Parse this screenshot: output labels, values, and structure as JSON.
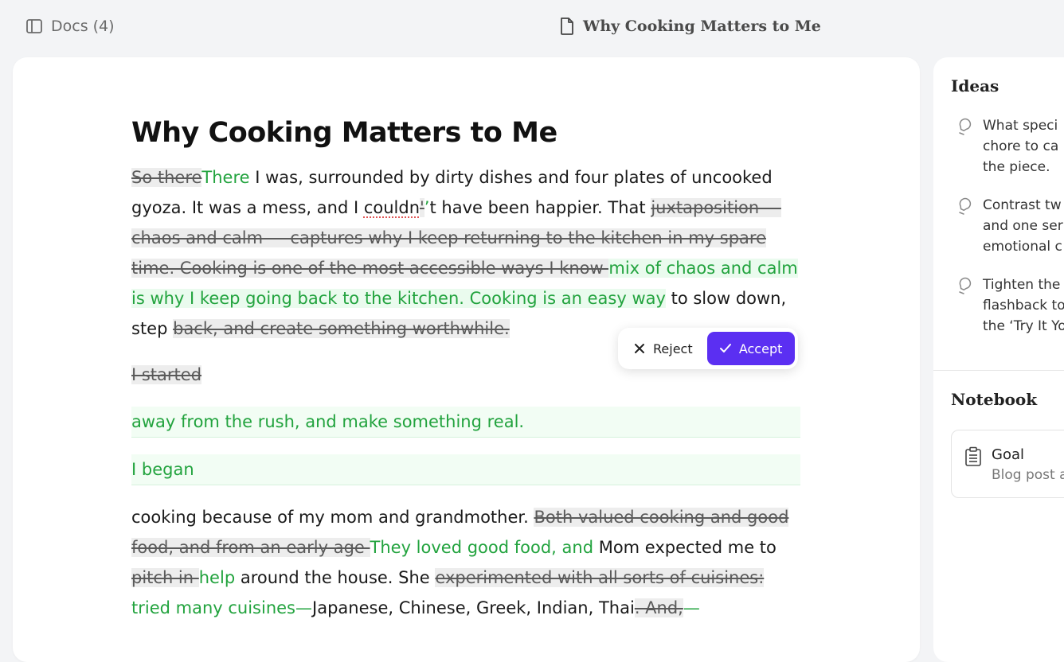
{
  "topbar": {
    "docs_label": "Docs (4)",
    "doc_title": "Why Cooking Matters to Me"
  },
  "document": {
    "title": "Why Cooking Matters to Me",
    "p1": {
      "del_1": "So there",
      "ins_1": "There",
      "text_1": " I was, surrounded by dirty dishes and four plates of uncooked gyoza. It was a mess, and I ",
      "spell_word": "couldn",
      "del_2": "'",
      "ins_2": "’",
      "text_2": "t have been happier. That ",
      "del_3": "juxtaposition — chaos and calm — captures why I keep returning to the kitchen in my spare time. Cooking is one of the most accessible ways I know ",
      "ins_3": "mix of chaos and calm is why I keep going back to the kitchen. Cooking is an easy way",
      "text_3": " to slow down, step ",
      "del_4": "back, and create something worthwhile."
    },
    "del_block": "I started",
    "ins_block_1": "away from the rush, and make something real.",
    "ins_block_2": "I began",
    "p2": {
      "text_1": " cooking because of my mom and grandmother. ",
      "del_1": "Both valued cooking and good food, and from an early age ",
      "ins_1": "They loved good food, and",
      "text_2": " Mom expected me to ",
      "del_2": "pitch in ",
      "ins_2": "help",
      "text_3": " around the house. She ",
      "del_3": "experimented with all sorts of cuisines: ",
      "ins_3": "tried many cuisines—",
      "text_4": "Japanese, Chinese, Greek, Indian, Thai",
      "del_4": ". And,",
      "ins_4": "—"
    }
  },
  "popover": {
    "reject_label": "Reject",
    "accept_label": "Accept"
  },
  "sidebar": {
    "ideas_title": "Ideas",
    "ideas": [
      {
        "lines": [
          "What speci",
          "chore to ca",
          "the piece."
        ]
      },
      {
        "lines": [
          "Contrast tw",
          "and one ser",
          "emotional c"
        ]
      },
      {
        "lines": [
          "Tighten the",
          "flashback to",
          "the ‘Try It Yo"
        ]
      }
    ],
    "notebook_title": "Notebook",
    "goal_label": "Goal",
    "goal_sub": "Blog post a"
  },
  "colors": {
    "accent": "#5b2ff2",
    "insert": "#22a33e",
    "background": "#f3f4f6"
  }
}
